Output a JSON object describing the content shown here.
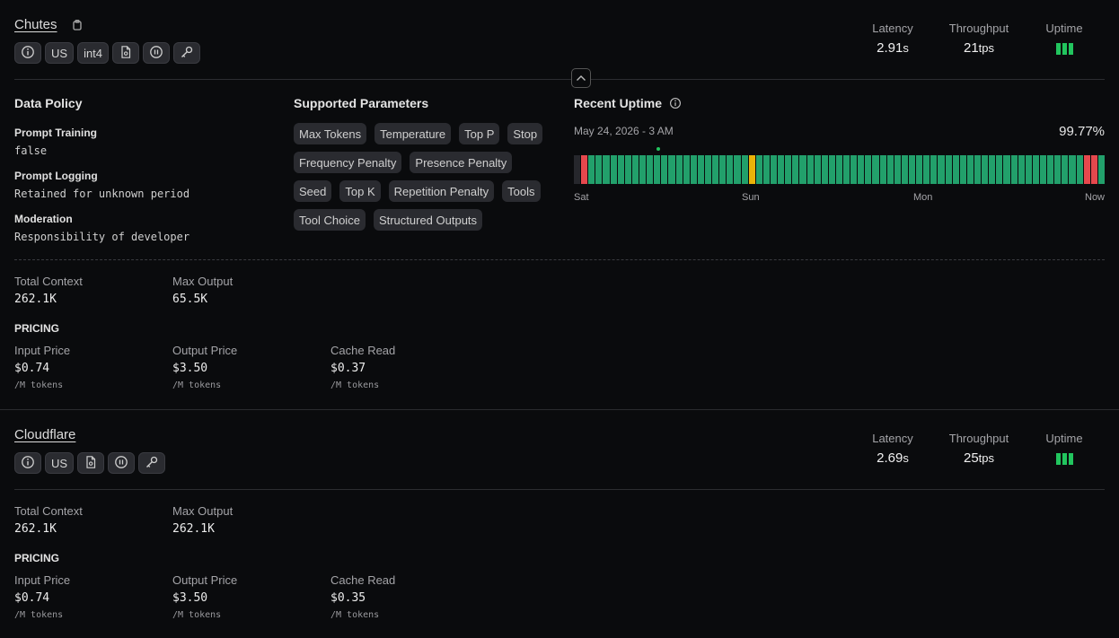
{
  "providers": [
    {
      "name": "Chutes",
      "chips": [
        "info-icon",
        "US",
        "int4",
        "document-icon",
        "pause-icon",
        "key-icon"
      ],
      "stats": {
        "latency_label": "Latency",
        "latency_value": "2.91",
        "latency_unit": "s",
        "throughput_label": "Throughput",
        "throughput_value": "21",
        "throughput_unit": "tps",
        "uptime_label": "Uptime"
      },
      "data_policy": {
        "title": "Data Policy",
        "prompt_training_label": "Prompt Training",
        "prompt_training_value": "false",
        "prompt_logging_label": "Prompt Logging",
        "prompt_logging_value": "Retained for unknown period",
        "moderation_label": "Moderation",
        "moderation_value": "Responsibility of developer"
      },
      "supported_parameters": {
        "title": "Supported Parameters",
        "items": [
          "Max Tokens",
          "Temperature",
          "Top P",
          "Stop",
          "Frequency Penalty",
          "Presence Penalty",
          "Seed",
          "Top K",
          "Repetition Penalty",
          "Tools",
          "Tool Choice",
          "Structured Outputs"
        ]
      },
      "recent_uptime": {
        "title": "Recent Uptime",
        "date": "May 24, 2026 - 3 AM",
        "percent": "99.77%",
        "axis": [
          "Sat",
          "Sun",
          "Mon",
          "Now"
        ],
        "colors": {
          "up": "#22a06b",
          "degraded": "#eab308",
          "down": "#e5484d",
          "none": "#26272c"
        }
      },
      "context": {
        "total_context_label": "Total Context",
        "total_context_value": "262.1K",
        "max_output_label": "Max Output",
        "max_output_value": "65.5K"
      },
      "pricing": {
        "title": "PRICING",
        "input_label": "Input Price",
        "input_value": "$0.74",
        "output_label": "Output Price",
        "output_value": "$3.50",
        "cache_label": "Cache Read",
        "cache_value": "$0.37",
        "per_unit": "/M tokens"
      }
    },
    {
      "name": "Cloudflare",
      "chips": [
        "info-icon",
        "US",
        "document-icon",
        "pause-icon",
        "key-icon"
      ],
      "stats": {
        "latency_label": "Latency",
        "latency_value": "2.69",
        "latency_unit": "s",
        "throughput_label": "Throughput",
        "throughput_value": "25",
        "throughput_unit": "tps",
        "uptime_label": "Uptime"
      },
      "context": {
        "total_context_label": "Total Context",
        "total_context_value": "262.1K",
        "max_output_label": "Max Output",
        "max_output_value": "262.1K"
      },
      "pricing": {
        "title": "PRICING",
        "input_label": "Input Price",
        "input_value": "$0.74",
        "output_label": "Output Price",
        "output_value": "$3.50",
        "cache_label": "Cache Read",
        "cache_value": "$0.35",
        "per_unit": "/M tokens"
      }
    }
  ]
}
